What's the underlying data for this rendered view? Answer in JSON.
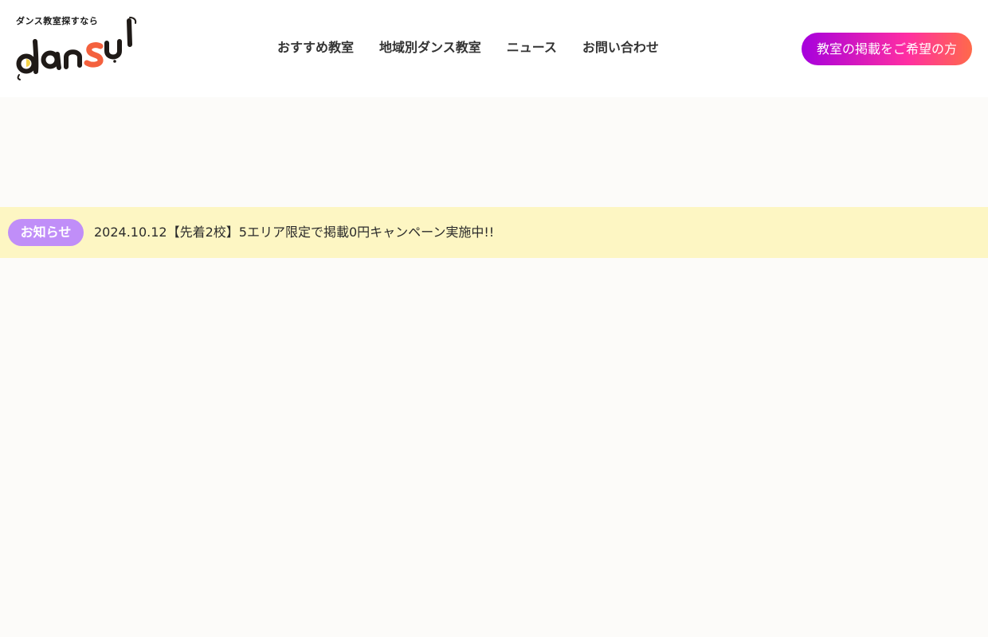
{
  "header": {
    "logo": {
      "tagline": "ダンス教室探すなら",
      "wordmark": "dansul"
    },
    "nav": [
      {
        "label": "おすすめ教室"
      },
      {
        "label": "地域別ダンス教室"
      },
      {
        "label": "ニュース"
      },
      {
        "label": "お問い合わせ"
      }
    ],
    "cta": {
      "label": "教室の掲載をご希望の方"
    }
  },
  "notice": {
    "badge": "お知らせ",
    "text": "2024.10.12【先着2校】5エリア限定で掲載0円キャンペーン実施中!!"
  },
  "colors": {
    "page_background": "#fcfbf9",
    "notice_background": "#fdf6c3",
    "notice_badge": "#c08ef8",
    "cta_gradient": [
      "#a600dd",
      "#ff2ea2",
      "#ff6a4a"
    ],
    "logo_accent": "#f4613e",
    "logo_dark": "#1f1a17",
    "logo_yellow": "#f5d34a"
  }
}
